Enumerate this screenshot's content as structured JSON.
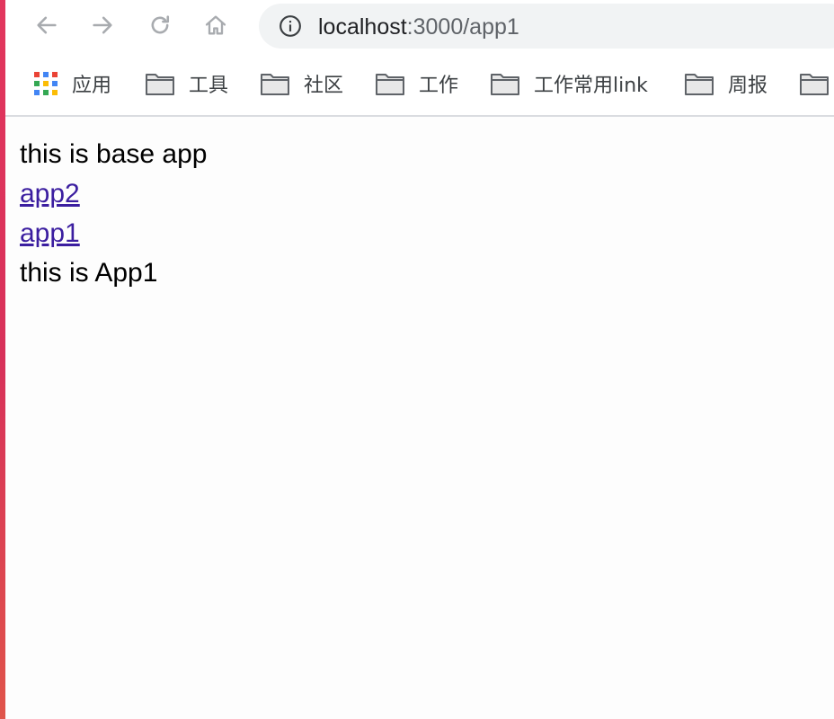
{
  "address_bar": {
    "host": "localhost",
    "path": ":3000/app1"
  },
  "toolbar": {
    "back_icon": "arrow-left-icon",
    "forward_icon": "arrow-right-icon",
    "reload_icon": "reload-icon",
    "home_icon": "home-icon",
    "info_icon": "info-circle-icon"
  },
  "bookmarks": {
    "apps_label": "应用",
    "folders": [
      "工具",
      "社区",
      "工作",
      "工作常用link",
      "周报"
    ]
  },
  "page": {
    "heading": "this is base app",
    "link1": "app2",
    "link2": "app1",
    "child_text": "this is App1"
  },
  "colors": {
    "link": "#3b1ea0",
    "omnibox": "#f1f3f4",
    "edge": "#e2365d"
  }
}
